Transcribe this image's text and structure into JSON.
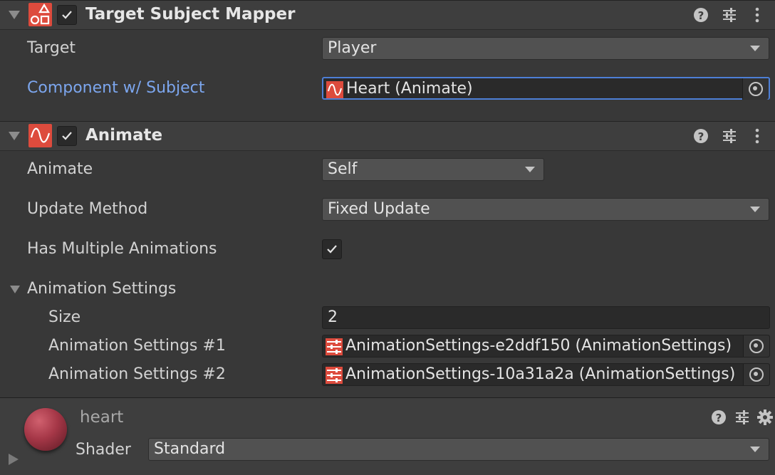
{
  "components": [
    {
      "title": "Target Subject Mapper",
      "enabled": true,
      "fields": {
        "target_label": "Target",
        "target_value": "Player",
        "component_label": "Component w/ Subject",
        "component_value": "Heart (Animate)"
      }
    },
    {
      "title": "Animate",
      "enabled": true,
      "fields": {
        "animate_label": "Animate",
        "animate_value": "Self",
        "update_method_label": "Update Method",
        "update_method_value": "Fixed Update",
        "has_multiple_label": "Has Multiple Animations",
        "has_multiple_checked": true,
        "animation_settings_label": "Animation Settings",
        "size_label": "Size",
        "size_value": "2",
        "items": [
          {
            "label": "Animation Settings #1",
            "value": "AnimationSettings-e2ddf150 (AnimationSettings)"
          },
          {
            "label": "Animation Settings #2",
            "value": "AnimationSettings-10a31a2a (AnimationSettings)"
          }
        ]
      }
    }
  ],
  "material": {
    "name": "heart",
    "shader_label": "Shader",
    "shader_value": "Standard"
  },
  "colors": {
    "accent_red": "#dd4b3d",
    "link_blue": "#7ca6ee",
    "focus_blue": "#4d7fd6",
    "background": "#383838"
  },
  "icons": [
    "shapes-icon",
    "wave-icon",
    "help-icon",
    "preset-sliders-icon",
    "kebab-menu-icon",
    "object-picker-icon",
    "settings-asset-icon",
    "gear-icon",
    "material-sphere-icon"
  ]
}
